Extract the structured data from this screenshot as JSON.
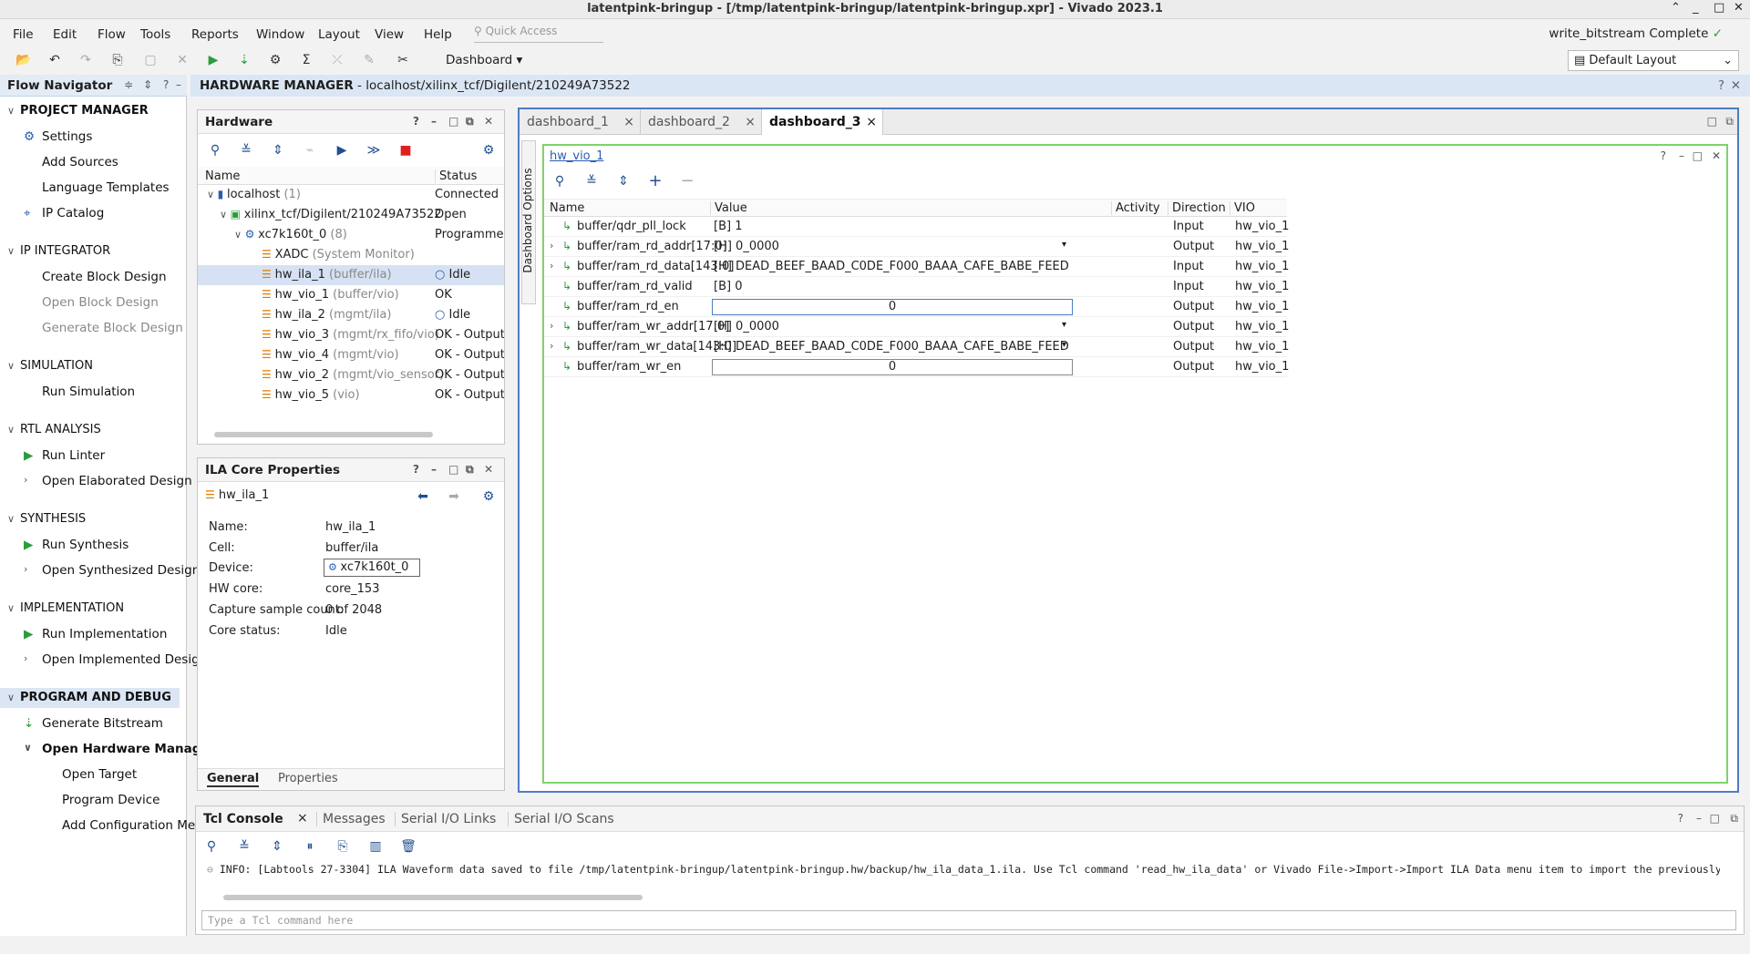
{
  "window": {
    "title": "latentpink-bringup - [/tmp/latentpink-bringup/latentpink-bringup.xpr] - Vivado 2023.1"
  },
  "menu": [
    "File",
    "Edit",
    "Flow",
    "Tools",
    "Reports",
    "Window",
    "Layout",
    "View",
    "Help"
  ],
  "quick_access": "Quick Access",
  "status": "write_bitstream Complete",
  "toolbar": {
    "dashboard": "Dashboard",
    "layout": "Default Layout"
  },
  "flow_nav": {
    "title": "Flow Navigator",
    "sections": [
      {
        "name": "PROJECT MANAGER",
        "items": [
          "Settings",
          "Add Sources",
          "Language Templates",
          "IP Catalog"
        ]
      },
      {
        "name": "IP INTEGRATOR",
        "items": [
          "Create Block Design",
          "Open Block Design",
          "Generate Block Design"
        ]
      },
      {
        "name": "SIMULATION",
        "items": [
          "Run Simulation"
        ]
      },
      {
        "name": "RTL ANALYSIS",
        "items": [
          "Run Linter",
          "Open Elaborated Design"
        ]
      },
      {
        "name": "SYNTHESIS",
        "items": [
          "Run Synthesis",
          "Open Synthesized Design"
        ]
      },
      {
        "name": "IMPLEMENTATION",
        "items": [
          "Run Implementation",
          "Open Implemented Design"
        ]
      },
      {
        "name": "PROGRAM AND DEBUG",
        "items": [
          "Generate Bitstream",
          "Open Hardware Manager",
          "Open Target",
          "Program Device",
          "Add Configuration Memory Device"
        ]
      }
    ]
  },
  "hm": {
    "title": "HARDWARE MANAGER",
    "path": " - localhost/xilinx_tcf/Digilent/210249A73522"
  },
  "hardware": {
    "title": "Hardware",
    "cols": [
      "Name",
      "Status"
    ],
    "rows": [
      {
        "name": "localhost",
        "extra": " (1)",
        "status": "Connected"
      },
      {
        "name": "xilinx_tcf/Digilent/210249A73522",
        "extra": "",
        "status": "Open"
      },
      {
        "name": "xc7k160t_0",
        "extra": " (8)",
        "status": "Programmed"
      },
      {
        "name": "XADC",
        "extra": " (System Monitor)",
        "status": ""
      },
      {
        "name": "hw_ila_1",
        "extra": " (buffer/ila)",
        "status": "Idle"
      },
      {
        "name": "hw_vio_1",
        "extra": " (buffer/vio)",
        "status": "OK"
      },
      {
        "name": "hw_ila_2",
        "extra": " (mgmt/ila)",
        "status": "Idle"
      },
      {
        "name": "hw_vio_3",
        "extra": " (mgmt/rx_fifo/vio)",
        "status": "OK - Outputs Reset"
      },
      {
        "name": "hw_vio_4",
        "extra": " (mgmt/vio)",
        "status": "OK - Outputs Reset"
      },
      {
        "name": "hw_vio_2",
        "extra": " (mgmt/vio_sensor)",
        "status": "OK - Outputs Reset"
      },
      {
        "name": "hw_vio_5",
        "extra": " (vio)",
        "status": "OK - Outputs Reset"
      }
    ]
  },
  "ila": {
    "title": "ILA Core Properties",
    "core": "hw_ila_1",
    "props": [
      [
        "Name:",
        "hw_ila_1"
      ],
      [
        "Cell:",
        "buffer/ila"
      ],
      [
        "Device:",
        "xc7k160t_0"
      ],
      [
        "HW core:",
        "core_153"
      ],
      [
        "Capture sample count:",
        "0 of 2048"
      ],
      [
        "Core status:",
        "Idle"
      ]
    ],
    "tabs": [
      "General",
      "Properties"
    ]
  },
  "dash": {
    "tabs": [
      "dashboard_1",
      "dashboard_2",
      "dashboard_3"
    ],
    "options": "Dashboard Options",
    "vio": "hw_vio_1",
    "cols": [
      "Name",
      "Value",
      "Activity",
      "Direction",
      "VIO"
    ],
    "rows": [
      {
        "name": "buffer/qdr_pll_lock",
        "value": "[B] 1",
        "dir": "Input",
        "vio": "hw_vio_1",
        "exp": false,
        "mode": "text"
      },
      {
        "name": "buffer/ram_rd_addr[17:0]",
        "value": "[H] 0_0000",
        "dir": "Output",
        "vio": "hw_vio_1",
        "exp": true,
        "mode": "drop"
      },
      {
        "name": "buffer/ram_rd_data[143:0]",
        "value": "[H] DEAD_BEEF_BAAD_C0DE_F000_BAAA_CAFE_BABE_FEED",
        "dir": "Input",
        "vio": "hw_vio_1",
        "exp": true,
        "mode": "text"
      },
      {
        "name": "buffer/ram_rd_valid",
        "value": "[B] 0",
        "dir": "Input",
        "vio": "hw_vio_1",
        "exp": false,
        "mode": "text"
      },
      {
        "name": "buffer/ram_rd_en",
        "value": "0",
        "dir": "Output",
        "vio": "hw_vio_1",
        "exp": false,
        "mode": "box-sel"
      },
      {
        "name": "buffer/ram_wr_addr[17:0]",
        "value": "[H] 0_0000",
        "dir": "Output",
        "vio": "hw_vio_1",
        "exp": true,
        "mode": "drop"
      },
      {
        "name": "buffer/ram_wr_data[143:0]",
        "value": "[H] DEAD_BEEF_BAAD_C0DE_F000_BAAA_CAFE_BABE_FEED",
        "dir": "Output",
        "vio": "hw_vio_1",
        "exp": true,
        "mode": "drop"
      },
      {
        "name": "buffer/ram_wr_en",
        "value": "0",
        "dir": "Output",
        "vio": "hw_vio_1",
        "exp": false,
        "mode": "box"
      }
    ]
  },
  "console": {
    "tabs": [
      "Tcl Console",
      "Messages",
      "Serial I/O Links",
      "Serial I/O Scans"
    ],
    "line": "INFO: [Labtools 27-3304] ILA Waveform data saved to file /tmp/latentpink-bringup/latentpink-bringup.hw/backup/hw_ila_data_1.ila. Use Tcl command 'read_hw_ila_data' or Vivado File->Import->Import ILA Data menu item to import the previously saved data.",
    "placeholder": "Type a Tcl command here"
  }
}
